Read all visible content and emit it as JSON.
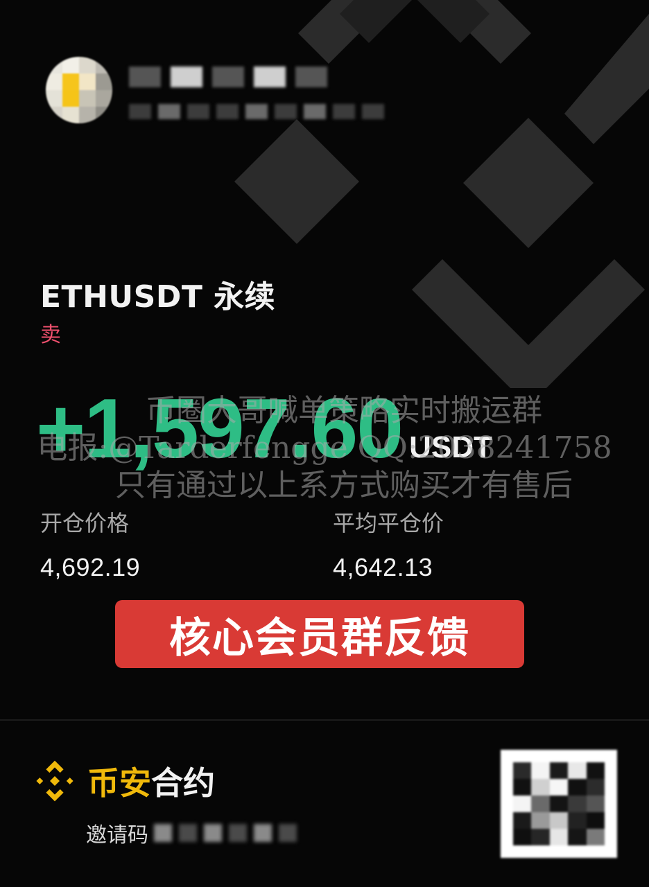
{
  "position": {
    "symbol": "ETHUSDT 永续",
    "side": "卖",
    "pnl_value": "+1,597.60",
    "pnl_unit": "USDT"
  },
  "stats": {
    "entry_label": "开仓价格",
    "entry_value": "4,692.19",
    "close_label": "平均平仓价",
    "close_value": "4,642.13"
  },
  "watermark": {
    "line1": "币圈大哥喊单策略实时搬运群",
    "line2": "电报:@Tarderfengge QQ:2038241758",
    "line3": "只有通过以上系方式购买才有售后"
  },
  "banner": {
    "text": "核心会员群反馈"
  },
  "footer": {
    "brand_yellow": "币安",
    "brand_white": "合约",
    "invite_label": "邀请码"
  },
  "colors": {
    "profit_green": "#2ebd85",
    "sell_red": "#f0506e",
    "banner_red": "#d93a35",
    "brand_yellow": "#f0b90b"
  },
  "icons": {
    "brand": "binance-logo-icon",
    "background": "binance-logo-watermark"
  }
}
